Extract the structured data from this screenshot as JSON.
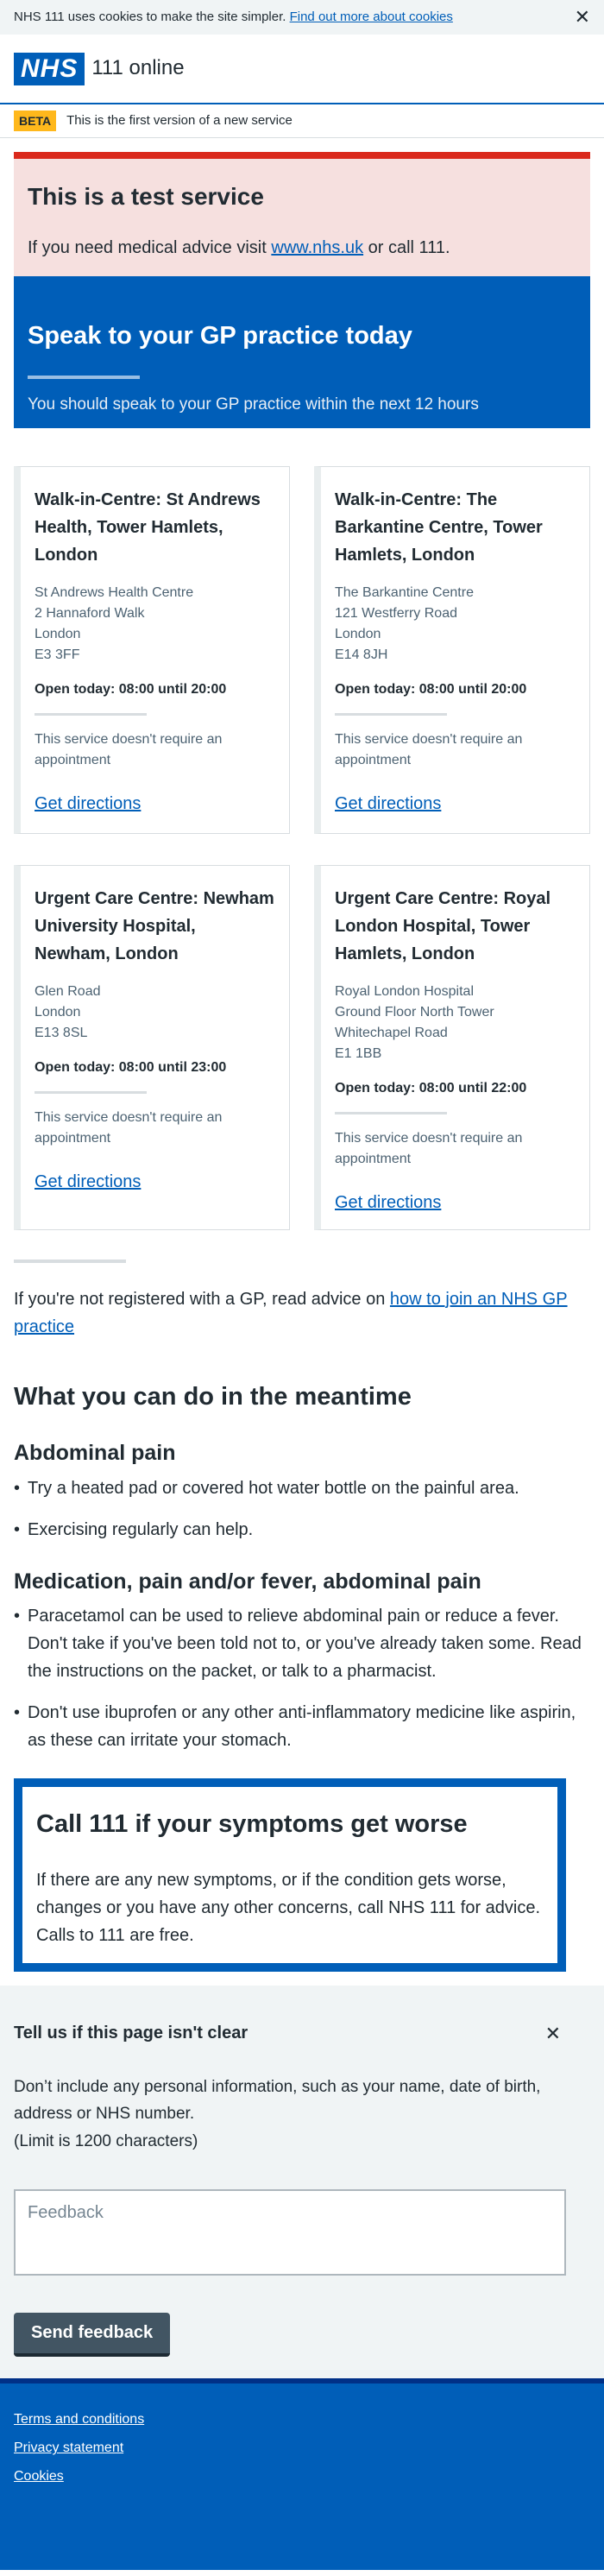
{
  "cookie": {
    "text": "NHS 111 uses cookies to make the site simpler.",
    "link": "Find out more about cookies",
    "close": "✕"
  },
  "header": {
    "logo": "NHS",
    "service": "111 online"
  },
  "beta": {
    "tag": "BETA",
    "text": "This is the first version of a new service"
  },
  "test_service": {
    "title": "This is a test service",
    "text_before": "If you need medical advice visit ",
    "link": "www.nhs.uk",
    "text_after": " or call 111."
  },
  "banner": {
    "title": "Speak to your GP practice today",
    "subtitle": "You should speak to your GP practice within the next 12 hours"
  },
  "services": [
    {
      "name": "Walk-in-Centre: St Andrews Health, Tower Hamlets, London",
      "address": [
        "St Andrews Health Centre",
        "2 Hannaford Walk",
        "London",
        "E3 3FF"
      ],
      "open": "Open today: 08:00 until 20:00",
      "note": "This service doesn't require an appointment",
      "directions": "Get directions"
    },
    {
      "name": "Walk-in-Centre: The Barkantine Centre, Tower Hamlets, London",
      "address": [
        "The Barkantine Centre",
        "121 Westferry Road",
        "London",
        "E14 8JH"
      ],
      "open": "Open today: 08:00 until 20:00",
      "note": "This service doesn't require an appointment",
      "directions": "Get directions"
    },
    {
      "name": "Urgent Care Centre: Newham University Hospital, Newham, London",
      "address": [
        "Glen Road",
        "London",
        "E13 8SL"
      ],
      "open": "Open today: 08:00 until 23:00",
      "note": "This service doesn't require an appointment",
      "directions": "Get directions"
    },
    {
      "name": "Urgent Care Centre: Royal London Hospital, Tower Hamlets, London",
      "address": [
        "Royal London Hospital",
        "Ground Floor North Tower",
        "Whitechapel Road",
        "E1 1BB"
      ],
      "open": "Open today: 08:00 until 22:00",
      "note": "This service doesn't require an appointment",
      "directions": "Get directions"
    }
  ],
  "not_registered": {
    "text": "If you're not registered with a GP, read advice on ",
    "link": "how to join an NHS GP practice"
  },
  "meantime": {
    "title": "What you can do in the meantime",
    "topics": [
      {
        "title": "Abdominal pain",
        "items": [
          "Try a heated pad or covered hot water bottle on the painful area.",
          "Exercising regularly can help."
        ]
      },
      {
        "title": "Medication, pain and/or fever, abdominal pain",
        "items": [
          "Paracetamol can be used to relieve abdominal pain or reduce a fever. Don't take if you've been told not to, or you've already taken some. Read the instructions on the packet, or talk to a pharmacist.",
          "Don't use ibuprofen or any other anti-inflammatory medicine like aspirin, as these can irritate your stomach."
        ]
      }
    ]
  },
  "call111": {
    "title": "Call 111 if your symptoms get worse",
    "text": "If there are any new symptoms, or if the condition gets worse, changes or you have any other concerns, call NHS 111 for advice. Calls to 111 are free."
  },
  "feedback": {
    "title": "Tell us if this page isn't clear",
    "close": "✕",
    "desc": "Don’t include any personal information, such as your name, date of birth, address or NHS number.",
    "limit": "(Limit is 1200 characters)",
    "placeholder": "Feedback",
    "button": "Send feedback"
  },
  "footer": {
    "links": [
      "Terms and conditions",
      "Privacy statement",
      "Cookies"
    ]
  }
}
